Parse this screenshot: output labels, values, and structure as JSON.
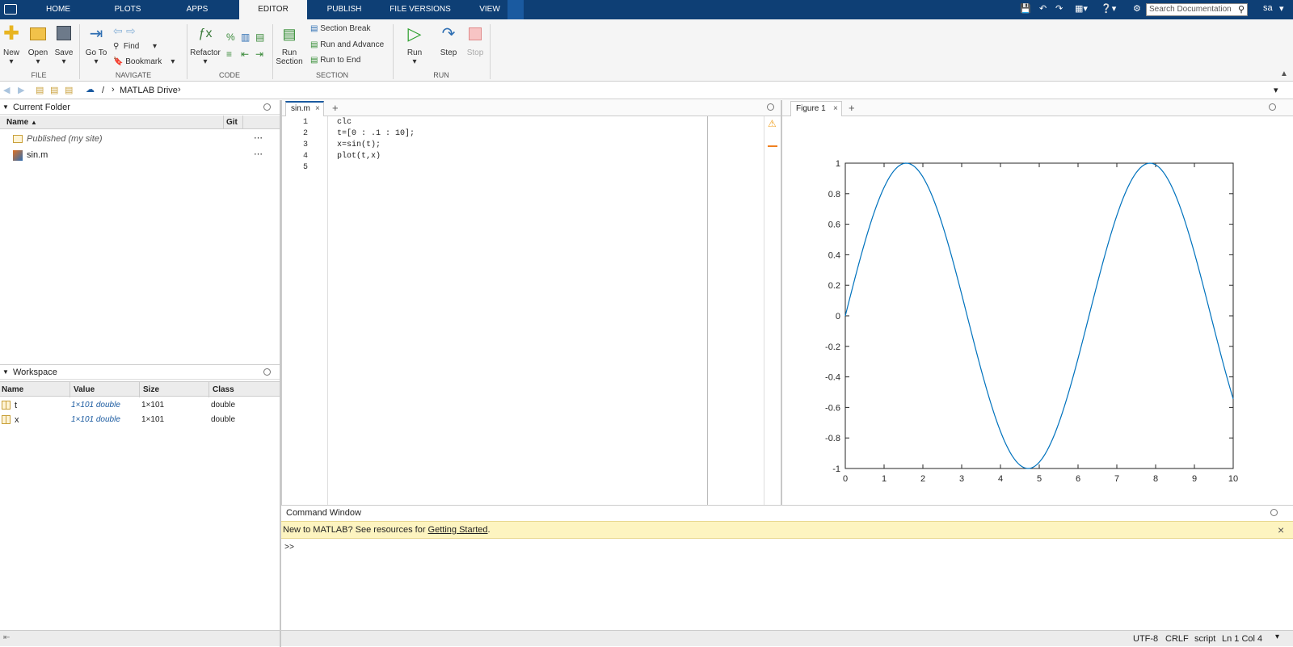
{
  "tabs": [
    {
      "label": "HOME"
    },
    {
      "label": "PLOTS"
    },
    {
      "label": "APPS"
    },
    {
      "label": "EDITOR"
    },
    {
      "label": "PUBLISH"
    },
    {
      "label": "FILE VERSIONS"
    },
    {
      "label": "VIEW"
    }
  ],
  "search": {
    "placeholder": "Search Documentation"
  },
  "user": "sa",
  "ribbon": {
    "file": {
      "new": "New",
      "open": "Open",
      "save": "Save",
      "section": "FILE"
    },
    "navigate": {
      "goto": "Go To",
      "find": "Find",
      "bookmark": "Bookmark",
      "section": "NAVIGATE"
    },
    "code": {
      "refactor": "Refactor",
      "section": "CODE"
    },
    "section": {
      "run_section": "Run Section",
      "run_section_1": "Run",
      "run_section_2": "Section",
      "section_break": "Section Break",
      "run_and_advance": "Run and Advance",
      "run_to_end": "Run to End",
      "section": "SECTION"
    },
    "run": {
      "run": "Run",
      "step": "Step",
      "stop": "Stop",
      "section": "RUN"
    }
  },
  "address": {
    "root": "/",
    "folder": "MATLAB Drive"
  },
  "current_folder": {
    "title": "Current Folder",
    "col_name": "Name",
    "col_git": "Git",
    "items": [
      {
        "name": "Published",
        "suffix": "(my site)"
      },
      {
        "name": "sin.m"
      }
    ]
  },
  "workspace": {
    "title": "Workspace",
    "columns": [
      "Name",
      "Value",
      "Size",
      "Class"
    ],
    "rows": [
      {
        "name": "t",
        "value": "1×101 double",
        "size": "1×101",
        "class": "double"
      },
      {
        "name": "x",
        "value": "1×101 double",
        "size": "1×101",
        "class": "double"
      }
    ]
  },
  "editor": {
    "tab": "sin.m",
    "lines": [
      "clc",
      "t=[0 : .1 : 10];",
      "x=sin(t);",
      "plot(t,x)",
      ""
    ]
  },
  "figure": {
    "tab": "Figure 1"
  },
  "command": {
    "title": "Command Window",
    "banner_text": "New to MATLAB? See resources for ",
    "banner_link": "Getting Started",
    "banner_end": ".",
    "prompt": ">>"
  },
  "statusbar": {
    "encoding": "UTF-8",
    "eol": "CRLF",
    "type": "script",
    "position": "Ln 1  Col 4"
  },
  "chart_data": {
    "type": "line",
    "title": "",
    "xlabel": "",
    "ylabel": "",
    "xlim": [
      0,
      10
    ],
    "ylim": [
      -1,
      1
    ],
    "xticks": [
      0,
      1,
      2,
      3,
      4,
      5,
      6,
      7,
      8,
      9,
      10
    ],
    "yticks": [
      -1,
      -0.8,
      -0.6,
      -0.4,
      -0.2,
      0,
      0.2,
      0.4,
      0.6,
      0.8,
      1
    ],
    "ytick_labels": [
      "-1",
      "-0.8",
      "-0.6",
      "-0.4",
      "-0.2",
      "0",
      "0.2",
      "0.4",
      "0.6",
      "0.8",
      "1"
    ],
    "grid": false,
    "series": [
      {
        "color": "#0072bd",
        "x": [
          0,
          0.5,
          1,
          1.5,
          2,
          2.5,
          3,
          3.5,
          4,
          4.5,
          5,
          5.5,
          6,
          6.5,
          7,
          7.5,
          8,
          8.5,
          9,
          9.5,
          10
        ],
        "y": [
          0,
          0.479,
          0.841,
          0.997,
          0.909,
          0.598,
          0.141,
          -0.351,
          -0.757,
          -0.978,
          -0.959,
          -0.706,
          -0.279,
          0.215,
          0.657,
          0.938,
          0.989,
          0.798,
          0.412,
          -0.075,
          -0.544
        ]
      }
    ]
  },
  "colors": {
    "tabbar": "#0e3f75",
    "accent": "#0072bd",
    "banner": "#fdf4c0"
  }
}
